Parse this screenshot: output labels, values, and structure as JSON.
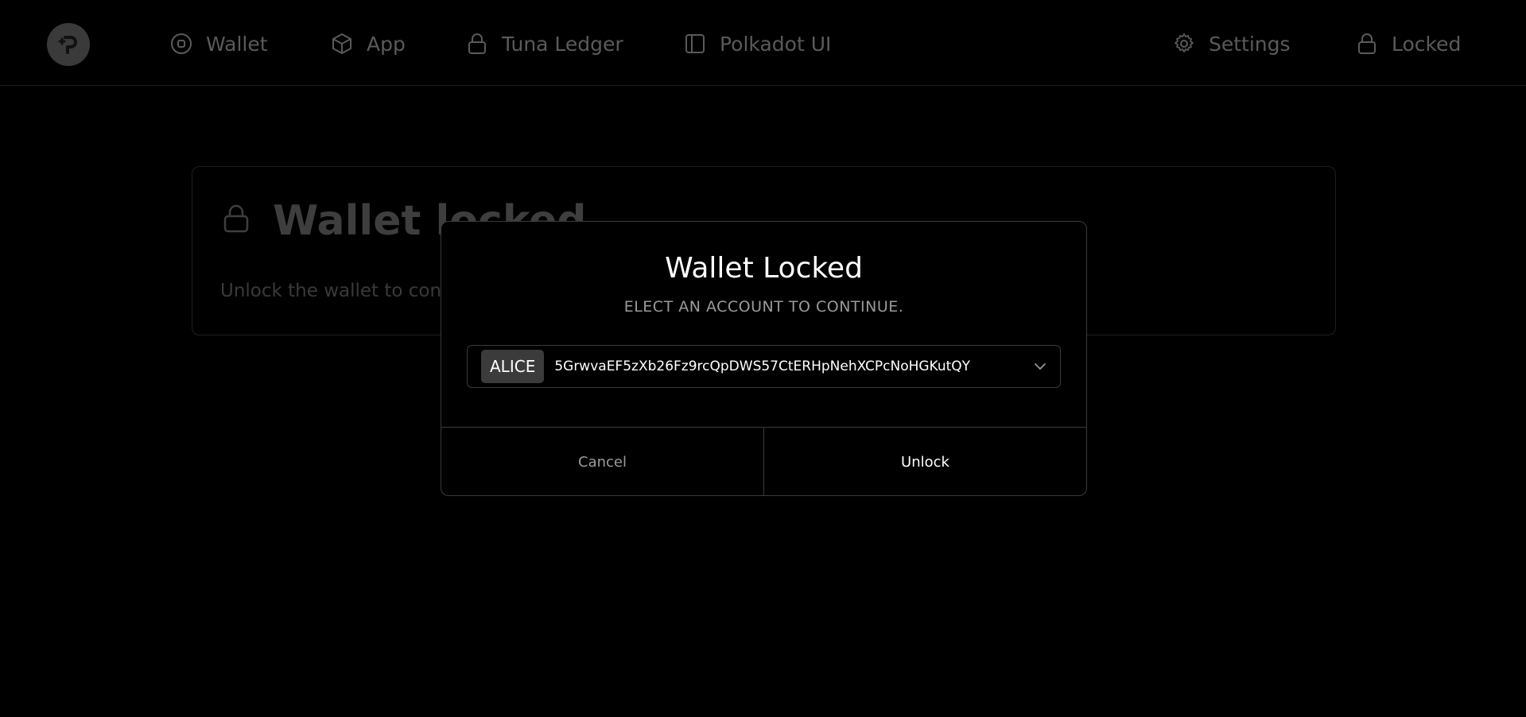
{
  "nav": {
    "items": [
      {
        "label": "Wallet",
        "icon": "target-icon"
      },
      {
        "label": "App",
        "icon": "cube-icon"
      },
      {
        "label": "Tuna Ledger",
        "icon": "lock-icon"
      },
      {
        "label": "Polkadot UI",
        "icon": "sidebar-panel-icon"
      }
    ],
    "settings_label": "Settings",
    "locked_label": "Locked"
  },
  "background_card": {
    "title": "Wallet locked",
    "subtitle": "Unlock the wallet to continue"
  },
  "modal": {
    "title": "Wallet Locked",
    "subtitle": "ELECT AN ACCOUNT TO CONTINUE.",
    "account": {
      "name": "ALICE",
      "address": "5GrwvaEF5zXb26Fz9rcQpDWS57CtERHpNehXCPcNoHGKutQY"
    },
    "cancel_label": "Cancel",
    "unlock_label": "Unlock"
  },
  "colors": {
    "background": "#000000",
    "dimmed_text": "#5a5a5a",
    "border": "#3a3a3a",
    "muted_text": "#9a9a9a"
  }
}
